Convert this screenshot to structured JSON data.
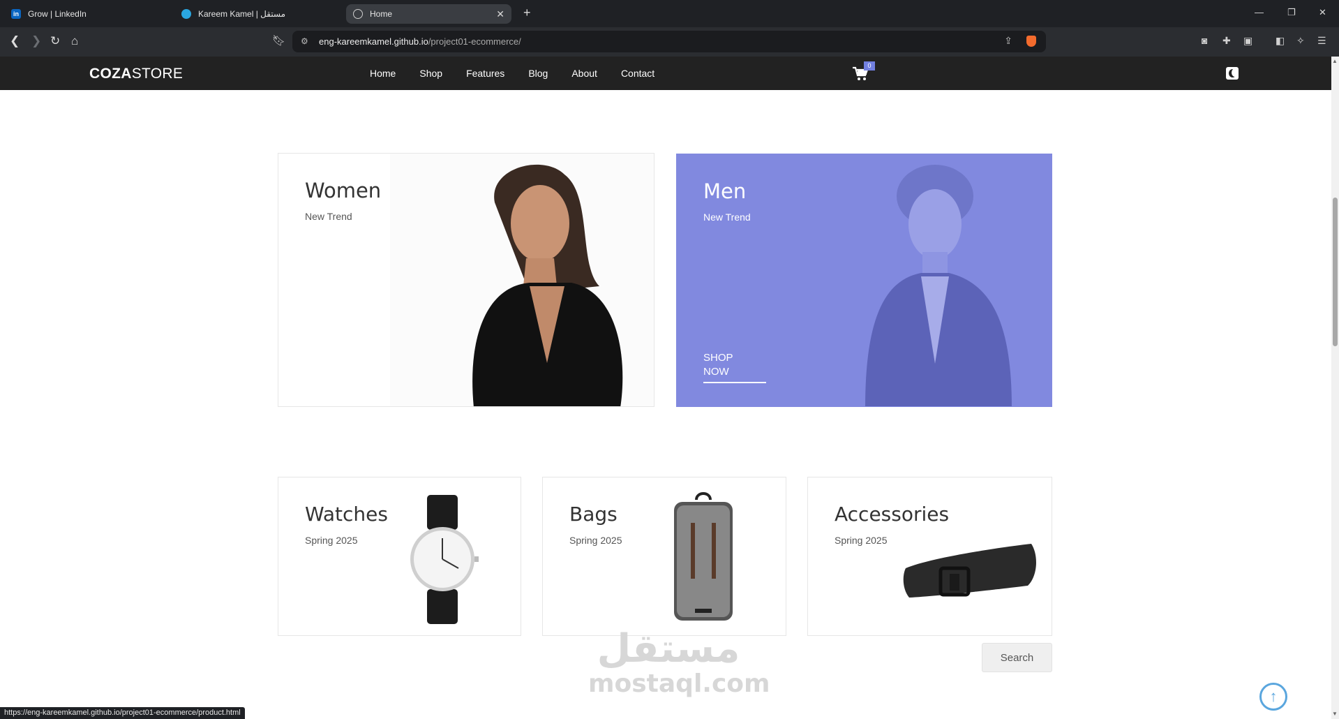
{
  "browser": {
    "tabs": [
      {
        "label": "Grow | LinkedIn",
        "icon": "linkedin-icon"
      },
      {
        "label": "Kareem Kamel | مستقل",
        "icon": "mostaql-icon"
      },
      {
        "label": "Home",
        "icon": "globe-icon",
        "active": true
      }
    ],
    "url_host": "eng-kareemkamel.github.io",
    "url_path": "/project01-ecommerce/",
    "status_url": "https://eng-kareemkamel.github.io/project01-ecommerce/product.html"
  },
  "site": {
    "logo_bold": "COZA",
    "logo_regular": "STORE",
    "nav": [
      "Home",
      "Shop",
      "Features",
      "Blog",
      "About",
      "Contact"
    ],
    "cart_count": "0",
    "accent_color": "#717fe0"
  },
  "banners": {
    "women": {
      "title": "Women",
      "subtitle": "New Trend"
    },
    "men": {
      "title": "Men",
      "subtitle": "New Trend",
      "cta_line1": "SHOP",
      "cta_line2": "NOW"
    },
    "watches": {
      "title": "Watches",
      "subtitle": "Spring 2025"
    },
    "bags": {
      "title": "Bags",
      "subtitle": "Spring 2025"
    },
    "accessories": {
      "title": "Accessories",
      "subtitle": "Spring 2025"
    }
  },
  "search_label": "Search",
  "watermark": {
    "arabic": "مستقل",
    "latin": "mostaql.com"
  }
}
